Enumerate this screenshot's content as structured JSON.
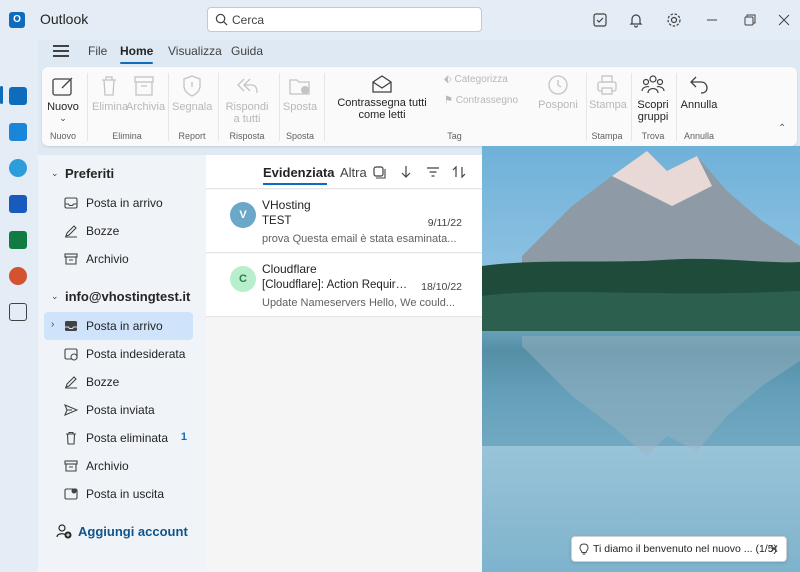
{
  "app": {
    "title": "Outlook",
    "logo_letter": "O"
  },
  "search": {
    "placeholder": "Cerca"
  },
  "menu": {
    "tabs": [
      "File",
      "Home",
      "Visualizza",
      "Guida"
    ],
    "active": "Home"
  },
  "ribbon": {
    "buttons": {
      "new": "Nuovo",
      "delete": "Elimina",
      "archive": "Archivia",
      "report": "Segnala",
      "reply_all": "Rispondi a tutti",
      "move": "Sposta",
      "mark_all_read": "Contrassegna tutti come letti",
      "categorize": "Categorizza",
      "flag": "Contrassegno",
      "snooze": "Posponi",
      "print": "Stampa",
      "discover_groups": "Scopri gruppi",
      "undo": "Annulla"
    },
    "groups": {
      "new": "Nuovo",
      "delete": "Elimina",
      "report": "Report",
      "respond": "Risposta",
      "move": "Sposta",
      "tag": "Tag",
      "print": "Stampa",
      "find": "Trova",
      "undo": "Annulla"
    }
  },
  "folders": {
    "favorites_header": "Preferiti",
    "favorites": [
      {
        "label": "Posta in arrivo",
        "icon": "inbox-icon"
      },
      {
        "label": "Bozze",
        "icon": "pencil-icon"
      },
      {
        "label": "Archivio",
        "icon": "archive-icon"
      }
    ],
    "account_header": "info@vhostingtest.it",
    "account_folders": [
      {
        "label": "Posta in arrivo",
        "icon": "inbox-icon",
        "selected": true,
        "count": ""
      },
      {
        "label": "Posta indesiderata",
        "icon": "junk-icon",
        "count": ""
      },
      {
        "label": "Bozze",
        "icon": "pencil-icon",
        "count": ""
      },
      {
        "label": "Posta inviata",
        "icon": "send-icon",
        "count": ""
      },
      {
        "label": "Posta eliminata",
        "icon": "trash-icon",
        "count": "1"
      },
      {
        "label": "Archivio",
        "icon": "archive-icon",
        "count": ""
      },
      {
        "label": "Posta in uscita",
        "icon": "outbox-icon",
        "count": ""
      }
    ],
    "add_account": "Aggiungi account"
  },
  "message_list": {
    "tabs": [
      "Evidenziata",
      "Altra"
    ],
    "active_tab": "Evidenziata",
    "messages": [
      {
        "avatar": "V",
        "avatar_bg": "#6aa7c9",
        "avatar_fg": "#ffffff",
        "sender": "VHosting",
        "subject": "TEST",
        "date": "9/11/22",
        "preview": "prova Questa email è stata esaminata..."
      },
      {
        "avatar": "C",
        "avatar_bg": "#b7eecb",
        "avatar_fg": "#2e7d4f",
        "sender": "Cloudflare",
        "subject": "[Cloudflare]: Action Required...",
        "date": "18/10/22",
        "preview": "Update Nameservers Hello, We could..."
      }
    ]
  },
  "notice": {
    "text": "Ti diamo il benvenuto nel nuovo ... (1/5)"
  },
  "colors": {
    "accent": "#0f6cbd",
    "selected": "#cfe4fa"
  }
}
